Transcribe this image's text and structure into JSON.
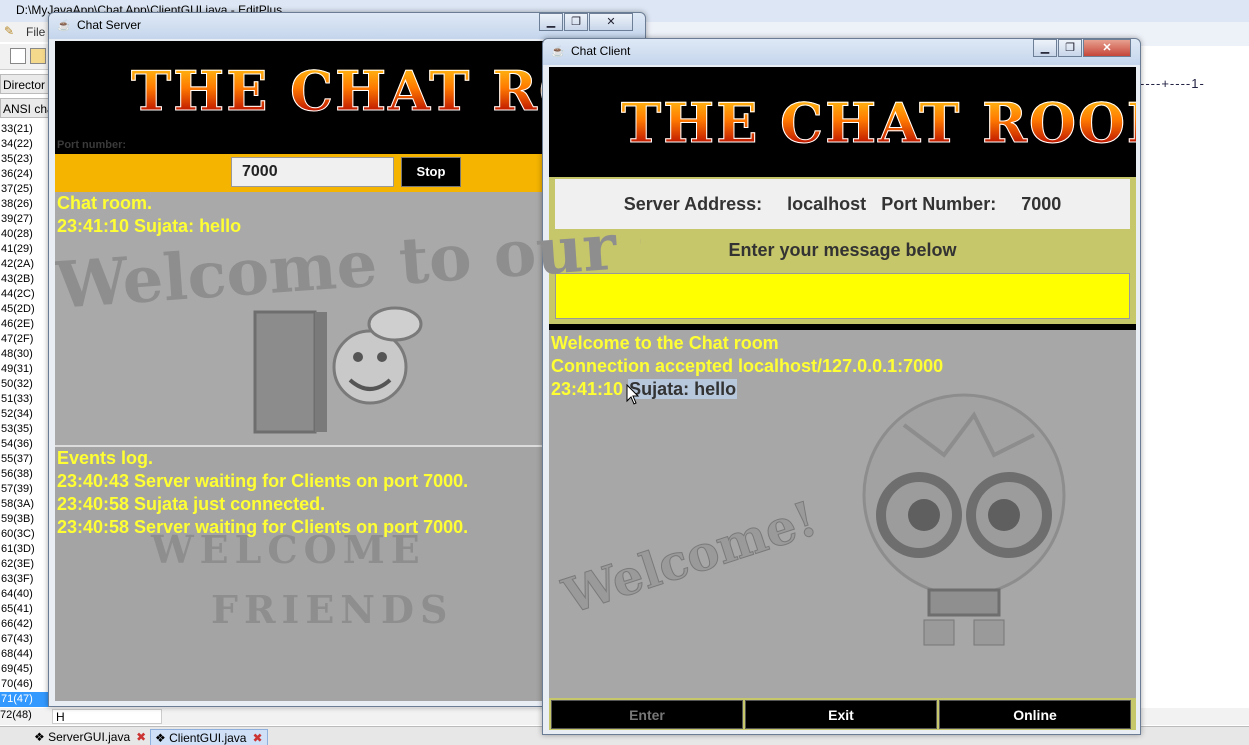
{
  "editor": {
    "title": "D:\\MyJavaApp\\Chat App\\ClientGUI.java - EditPlus",
    "menu_file": "File",
    "directory_label": "Director",
    "ansi_label": "ANSI cha",
    "char_rows": [
      "33(21)",
      "34(22)",
      "35(23)",
      "36(24)",
      "37(25)",
      "38(26)",
      "39(27)",
      "40(28)",
      "41(29)",
      "42(2A)",
      "43(2B)",
      "44(2C)",
      "45(2D)",
      "46(2E)",
      "47(2F)",
      "48(30)",
      "49(31)",
      "50(32)",
      "51(33)",
      "52(34)",
      "53(35)",
      "54(36)",
      "55(37)",
      "56(38)",
      "57(39)",
      "58(3A)",
      "59(3B)",
      "60(3C)",
      "61(3D)",
      "62(3E)",
      "63(3F)",
      "64(40)",
      "65(41)",
      "66(42)",
      "67(43)",
      "68(44)",
      "69(45)",
      "70(46)",
      "71(47)"
    ],
    "last_row": "72(48)",
    "char_input": "H",
    "ruler": "----+----1-",
    "tabs": [
      "ServerGUI.java",
      "ClientGUI.java"
    ],
    "active_tab": "ClientGUI.java"
  },
  "server": {
    "title": "Chat Server",
    "logo": "THE CHAT ROOM",
    "port_label": "Port number:",
    "port_value": "7000",
    "stop_label": "Stop",
    "chat_lines": [
      "Chat room.",
      "23:41:10 Sujata: hello"
    ],
    "chat_watermark": "Welcome to our Chat R",
    "event_lines": [
      "Events log.",
      "23:40:43 Server waiting for Clients on port 7000.",
      "23:40:58 Sujata just connected.",
      "23:40:58 Server waiting for Clients on port 7000."
    ],
    "events_watermark_1": "WELCOME",
    "events_watermark_2": "FRIENDS"
  },
  "client": {
    "title": "Chat Client",
    "logo": "THE CHAT ROOM",
    "server_address_label": "Server Address:",
    "server_address": "localhost",
    "port_number_label": "Port Number:",
    "port_number": "7000",
    "message_label": "Enter your message below",
    "message_value": "",
    "chat_line_1": "Welcome to the Chat room",
    "chat_line_2": "Connection accepted localhost/127.0.0.1:7000",
    "chat_line_3_time": "23:41:10",
    "chat_line_3_msg": "Sujata: hello",
    "watermark": "Welcome!",
    "buttons": {
      "enter": "Enter",
      "exit": "Exit",
      "online": "Online"
    }
  },
  "colors": {
    "chat_text": "#ffff33",
    "port_bar": "#f5b400",
    "client_panel": "#c6c66a",
    "message_field": "#ffff00"
  }
}
